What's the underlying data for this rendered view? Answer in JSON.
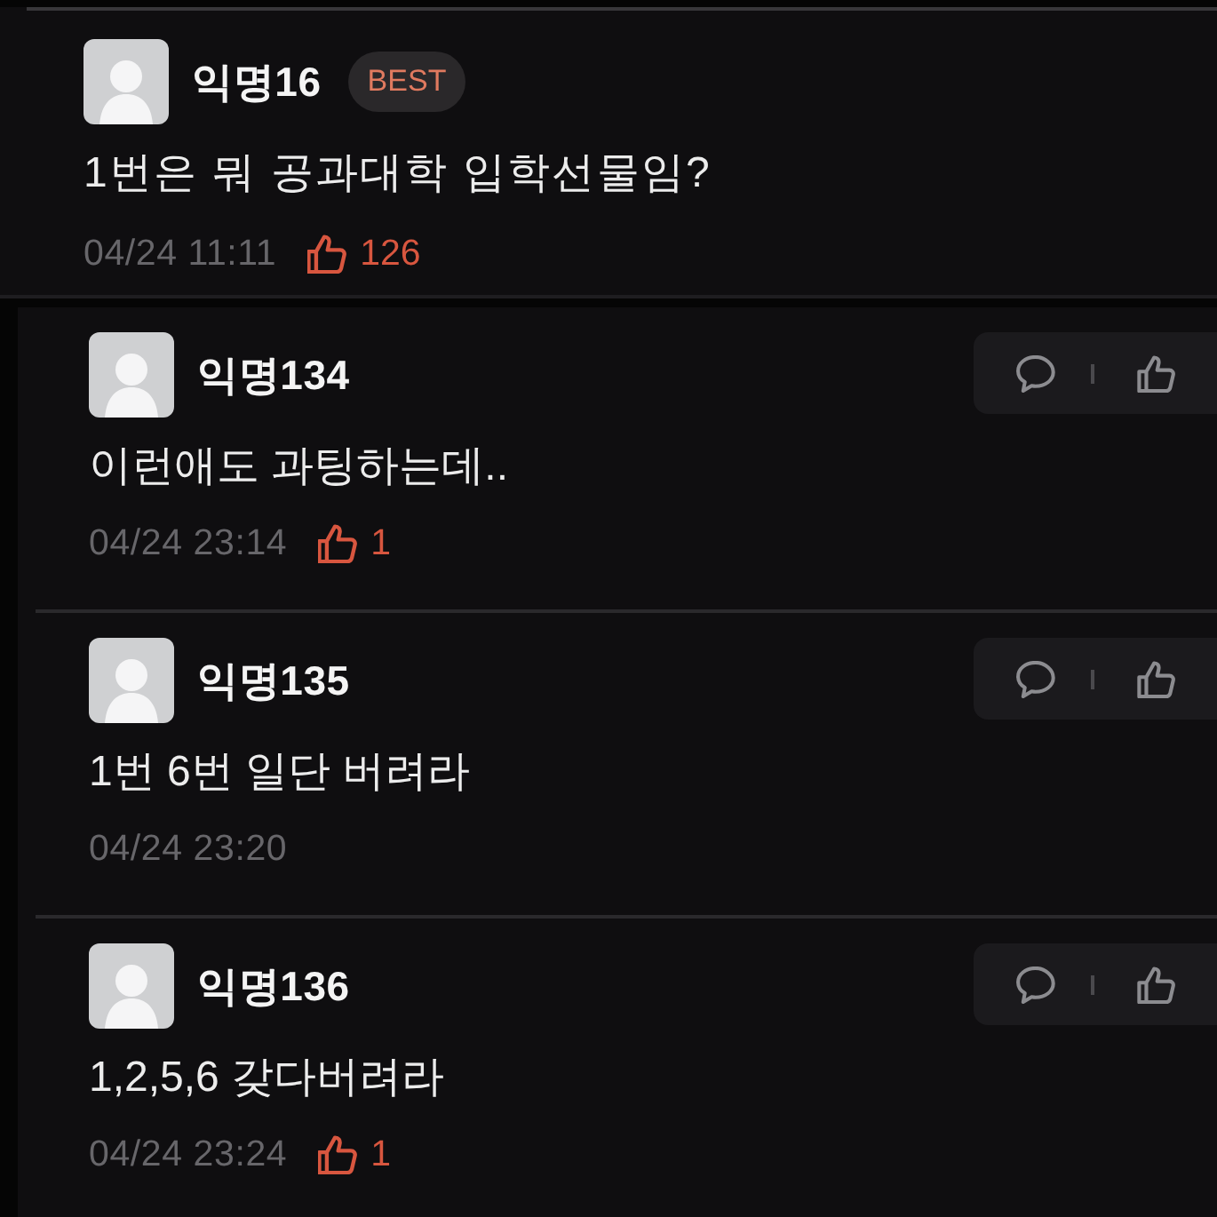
{
  "comments": [
    {
      "kind": "best",
      "author": "익명16",
      "badge": "BEST",
      "text": "1번은 뭐 공과대학 입학선물임?",
      "time": "04/24 11:11",
      "likes": "126"
    },
    {
      "kind": "regular",
      "author": "익명134",
      "text": "이런애도 과팅하는데..",
      "time": "04/24 23:14",
      "likes": "1"
    },
    {
      "kind": "regular",
      "author": "익명135",
      "text": "1번 6번 일단 버려라",
      "time": "04/24 23:20"
    },
    {
      "kind": "regular",
      "author": "익명136",
      "text": "1,2,5,6 갖다버려라",
      "time": "04/24 23:24",
      "likes": "1"
    }
  ]
}
